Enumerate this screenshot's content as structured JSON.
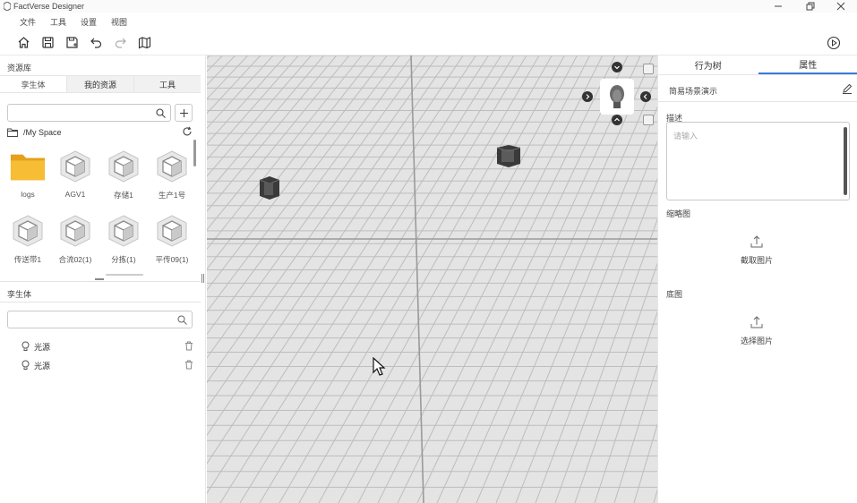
{
  "app": {
    "title": "FactVerse Designer"
  },
  "menu": [
    "文件",
    "工具",
    "设置",
    "视图"
  ],
  "toolbar": {
    "icons": [
      "home-icon",
      "save-icon",
      "save-as-icon",
      "undo-icon",
      "redo-icon",
      "map-icon"
    ],
    "play_icon": "play-icon"
  },
  "left": {
    "library_title": "资源库",
    "tabs": [
      "孪生体",
      "我的资源",
      "工具"
    ],
    "search_placeholder": "",
    "path": "/My Space",
    "assets": [
      {
        "label": "logs",
        "icon": "folder-icon"
      },
      {
        "label": "AGV1",
        "icon": "cube-icon"
      },
      {
        "label": "存储1",
        "icon": "cube-icon"
      },
      {
        "label": "生产1号",
        "icon": "cube-icon"
      },
      {
        "label": "传送带1",
        "icon": "cube-icon"
      },
      {
        "label": "合流02(1)",
        "icon": "cube-icon"
      },
      {
        "label": "分拣(1)",
        "icon": "cube-icon"
      },
      {
        "label": "平传09(1)",
        "icon": "cube-icon"
      }
    ],
    "twin_title": "孪生体",
    "twin_search_placeholder": "",
    "twins": [
      {
        "label": "光源",
        "icon": "lightbulb-icon"
      },
      {
        "label": "光源",
        "icon": "lightbulb-icon"
      }
    ]
  },
  "right": {
    "tabs": [
      "行为树",
      "属性"
    ],
    "active_tab": "属性",
    "scene_name": "简易场景演示",
    "desc_label": "描述",
    "desc_placeholder": "请输入",
    "thumb_label": "缩略图",
    "thumb_action": "截取图片",
    "base_label": "底图",
    "base_action": "选择图片"
  },
  "colors": {
    "accent": "#3a7bd5",
    "folder": "#f3b12b",
    "floor": "#e6e6e6"
  }
}
